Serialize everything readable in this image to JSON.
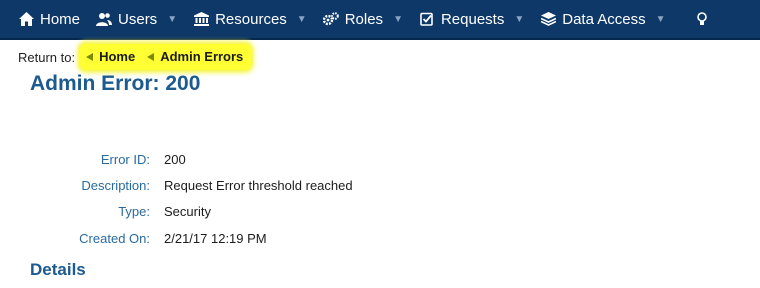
{
  "nav": {
    "items": [
      {
        "label": "Home",
        "icon": "home-icon",
        "has_caret": false
      },
      {
        "label": "Users",
        "icon": "users-icon",
        "has_caret": true
      },
      {
        "label": "Resources",
        "icon": "bank-icon",
        "has_caret": true
      },
      {
        "label": "Roles",
        "icon": "gears-icon",
        "has_caret": true
      },
      {
        "label": "Requests",
        "icon": "checkbox-icon",
        "has_caret": true
      },
      {
        "label": "Data Access",
        "icon": "layers-icon",
        "has_caret": true
      }
    ],
    "background": "#0d3868"
  },
  "return_to": {
    "label": "Return to:",
    "crumbs": [
      {
        "label": "Home"
      },
      {
        "label": "Admin Errors"
      }
    ],
    "highlight": "#ffff33"
  },
  "page_title": "Admin Error: 200",
  "fields": [
    {
      "label": "Error ID:",
      "value": "200"
    },
    {
      "label": "Description:",
      "value": "Request Error threshold reached"
    },
    {
      "label": "Type:",
      "value": "Security"
    },
    {
      "label": "Created On:",
      "value": "2/21/17 12:19 PM"
    }
  ],
  "details_heading": "Details"
}
